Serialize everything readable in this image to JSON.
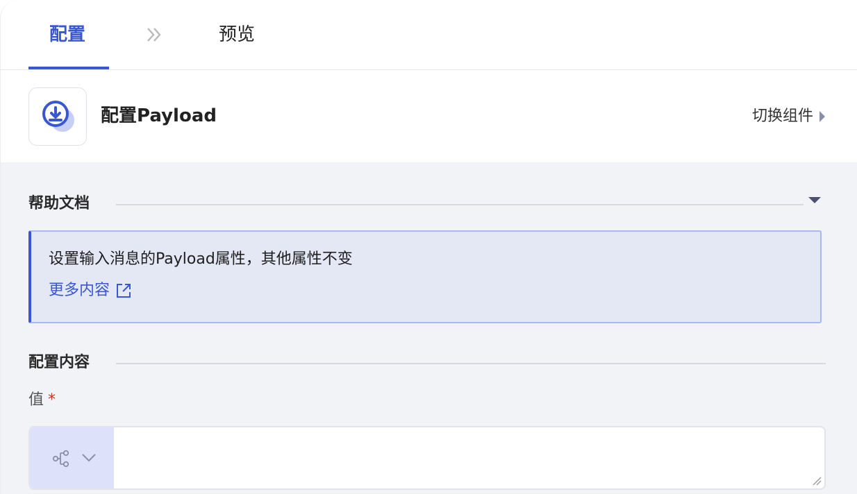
{
  "tabs": {
    "config": "配置",
    "preview": "预览",
    "separator_icon": "double-chevron-right-icon"
  },
  "header": {
    "icon": "download-payload-icon",
    "title": "配置Payload",
    "switch_label": "切换组件",
    "switch_icon": "caret-right-icon"
  },
  "help": {
    "title": "帮助文档",
    "description": "设置输入消息的Payload属性，其他属性不变",
    "more_link": "更多内容",
    "more_icon": "external-link-icon",
    "collapse_icon": "caret-down-icon"
  },
  "config_section": {
    "title": "配置内容",
    "field_label": "值",
    "required_mark": "*",
    "value": "",
    "type_icon": "flow-tree-icon",
    "type_dropdown_icon": "chevron-down-icon"
  },
  "colors": {
    "accent": "#3a57d2",
    "help_bg": "#e4e7f4",
    "content_bg": "#f2f3f6",
    "required": "#c0392b"
  }
}
